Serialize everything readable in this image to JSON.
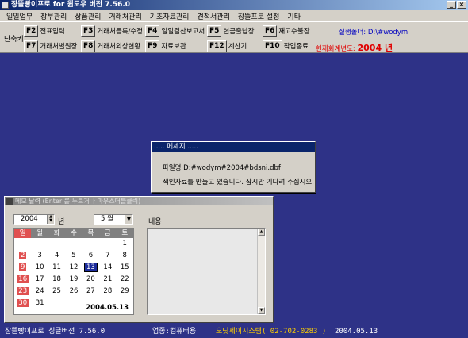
{
  "window": {
    "title": "장뜰빵이프로 for 윈도우 버전 7.56.0"
  },
  "menu": [
    "일일업무",
    "장부관리",
    "상품관리",
    "거래처관리",
    "기초자료관리",
    "견적서관리",
    "장뜰프로 설정",
    "기타"
  ],
  "toolbar": {
    "shortcut_label": "단축키",
    "row1": [
      {
        "key": "F2",
        "label": "전표입력"
      },
      {
        "key": "F3",
        "label": "거래처등록/수정"
      },
      {
        "key": "F4",
        "label": "일일결산보고서"
      },
      {
        "key": "F5",
        "label": "현금출납장"
      },
      {
        "key": "F6",
        "label": "재고수불장"
      }
    ],
    "row2": [
      {
        "key": "F7",
        "label": "거래처별원장"
      },
      {
        "key": "F8",
        "label": "거래처외상현황"
      },
      {
        "key": "F9",
        "label": "자료보관"
      },
      {
        "key": "F12",
        "label": "계산기"
      },
      {
        "key": "F10",
        "label": "작업종료"
      }
    ],
    "folder": "실행폴더: D:\\#wodym",
    "fiscal_label": "현재회계년도:",
    "fiscal_year": "2004 년"
  },
  "dialog": {
    "title": "..... 메세지 .....",
    "file_line": "파일명  D:#wodym#2004#bdsni.dbf",
    "message": "색인자료를 만들고 있습니다. 잠시만 기다려 주십시오."
  },
  "memo": {
    "title": "메모 달력 (Enter 를 누르거나 마우스더블클릭)",
    "year": "2004",
    "year_suffix": "년",
    "month": "5 월",
    "weekdays": [
      "일",
      "월",
      "화",
      "수",
      "목",
      "금",
      "토"
    ],
    "weeks": [
      [
        "",
        "",
        "",
        "",
        "",
        "",
        "1"
      ],
      [
        "2",
        "3",
        "4",
        "5",
        "6",
        "7",
        "8"
      ],
      [
        "9",
        "10",
        "11",
        "12",
        "13",
        "14",
        "15"
      ],
      [
        "16",
        "17",
        "18",
        "19",
        "20",
        "21",
        "22"
      ],
      [
        "23",
        "24",
        "25",
        "26",
        "27",
        "28",
        "29"
      ],
      [
        "30",
        "31",
        "",
        "",
        "",
        "",
        ""
      ]
    ],
    "selected_day": "13",
    "date_label": "2004.05.13",
    "content_label": "내용"
  },
  "status": {
    "product": "장뜰빵이프로 싱글버전 7.56.0",
    "business": "업종:컴퓨터용",
    "company": "오딧세이시스템( 02-702-0283 )",
    "date": "2004.05.13"
  },
  "colors": {
    "desktop": "#2e3287",
    "titlebar": "#0a246a",
    "fiscal_text": "#e00000",
    "sunday": "#e05050",
    "selected_day": "#1c2c9c"
  }
}
